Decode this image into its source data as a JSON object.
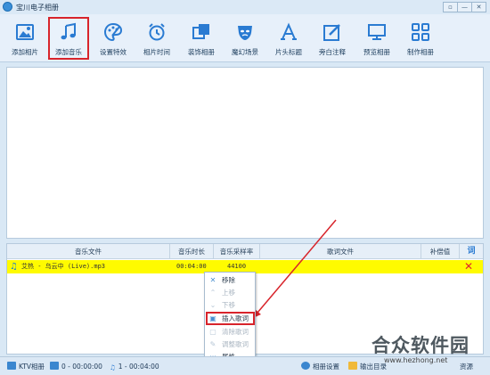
{
  "window": {
    "title": "宝川电子相册",
    "controls": [
      "▫",
      "—",
      "✕"
    ]
  },
  "toolbar": {
    "items": [
      {
        "label": "添加相片",
        "icon": "add-photo-icon",
        "active": false
      },
      {
        "label": "添加音乐",
        "icon": "music-note-icon",
        "active": true
      },
      {
        "label": "设置特效",
        "icon": "palette-icon",
        "active": false
      },
      {
        "label": "相片时间",
        "icon": "alarm-clock-icon",
        "active": false
      },
      {
        "label": "装饰相册",
        "icon": "decorate-icon",
        "active": false
      },
      {
        "label": "魔幻场景",
        "icon": "mask-icon",
        "active": false
      },
      {
        "label": "片头标题",
        "icon": "title-a-icon",
        "active": false
      },
      {
        "label": "旁白注释",
        "icon": "edit-note-icon",
        "active": false
      },
      {
        "label": "预览相册",
        "icon": "monitor-icon",
        "active": false
      },
      {
        "label": "制作相册",
        "icon": "grid-icon",
        "active": false
      }
    ],
    "accent": "#2a7bd2",
    "active_border": "#d8242b"
  },
  "music_table": {
    "columns": [
      "音乐文件",
      "音乐时长",
      "音乐采样率",
      "歌词文件",
      "补偿值",
      "词"
    ],
    "rows": [
      {
        "file": "艾热 - 乌云中 (Live).mp3",
        "duration": "00:04:00",
        "sample_rate": "44100",
        "lyrics": "",
        "offset": "",
        "delete": "✕"
      }
    ],
    "row_highlight": "#fffb00"
  },
  "context_menu": {
    "items": [
      {
        "label": "移除",
        "icon": "✕",
        "enabled": true
      },
      {
        "label": "上移",
        "icon": "⌃",
        "enabled": false
      },
      {
        "label": "下移",
        "icon": "⌄",
        "enabled": false
      },
      {
        "label": "插入歌词",
        "icon": "▣",
        "enabled": true,
        "highlighted": true
      },
      {
        "label": "清除歌词",
        "icon": "▢",
        "enabled": false
      },
      {
        "label": "调整歌词",
        "icon": "✎",
        "enabled": false
      },
      {
        "label": "属性",
        "icon": "···",
        "enabled": true
      }
    ]
  },
  "statusbar": {
    "ktv": "KTV相册",
    "photos": "0 - 00:00:00",
    "music": "1 - 00:04:00",
    "settings": "相册设置",
    "output": "输出目录",
    "resources": "资源"
  },
  "watermark": {
    "logo": "合众软件园",
    "url": "www.hezhong.net"
  }
}
